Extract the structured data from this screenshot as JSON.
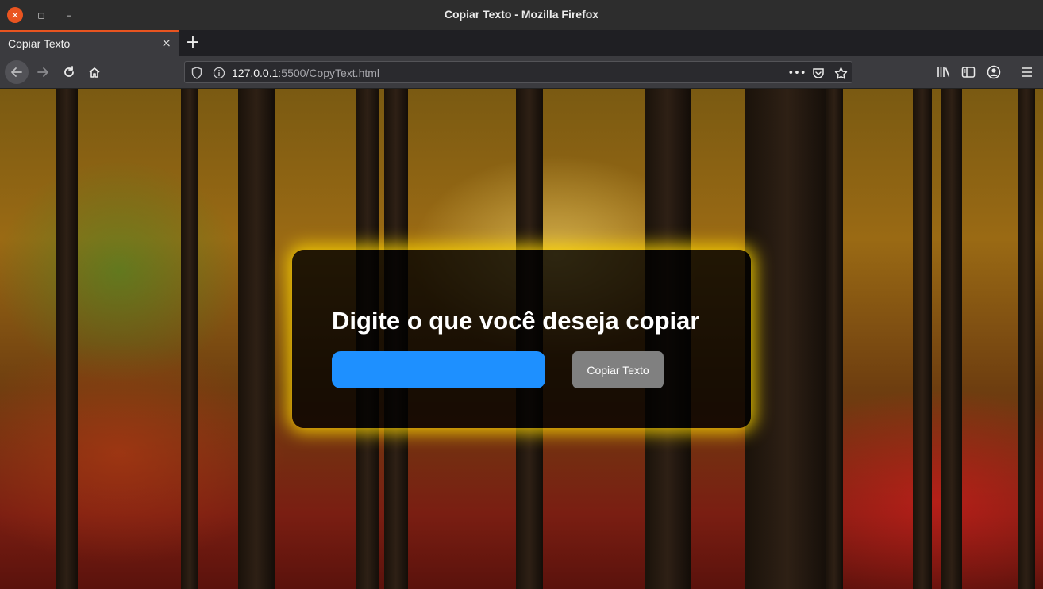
{
  "window": {
    "title": "Copiar Texto - Mozilla Firefox",
    "controls": {
      "close": "×",
      "maximize": "◻",
      "minimize": "–"
    }
  },
  "tab": {
    "title": "Copiar Texto",
    "close": "×",
    "new_tab": "+"
  },
  "urlbar": {
    "host": "127.0.0.1",
    "rest": ":5500/CopyText.html",
    "more": "•••"
  },
  "page": {
    "heading": "Digite o que você deseja copiar",
    "input": {
      "value": "",
      "placeholder": ""
    },
    "button_label": "Copiar Texto"
  },
  "colors": {
    "accent": "#e95420",
    "input_bg": "#1e90ff",
    "button_bg": "#808080",
    "card_glow": "#ffd700",
    "card_bg": "rgba(0,0,0,0.78)"
  },
  "icons": {
    "nav": [
      "back-arrow-icon",
      "forward-arrow-icon",
      "reload-icon",
      "home-icon"
    ],
    "url": [
      "shield-icon",
      "info-icon",
      "page-actions-icon",
      "pocket-icon",
      "bookmark-star-icon"
    ],
    "toolbar": [
      "library-icon",
      "sidebar-icon",
      "account-icon",
      "menu-icon"
    ]
  }
}
